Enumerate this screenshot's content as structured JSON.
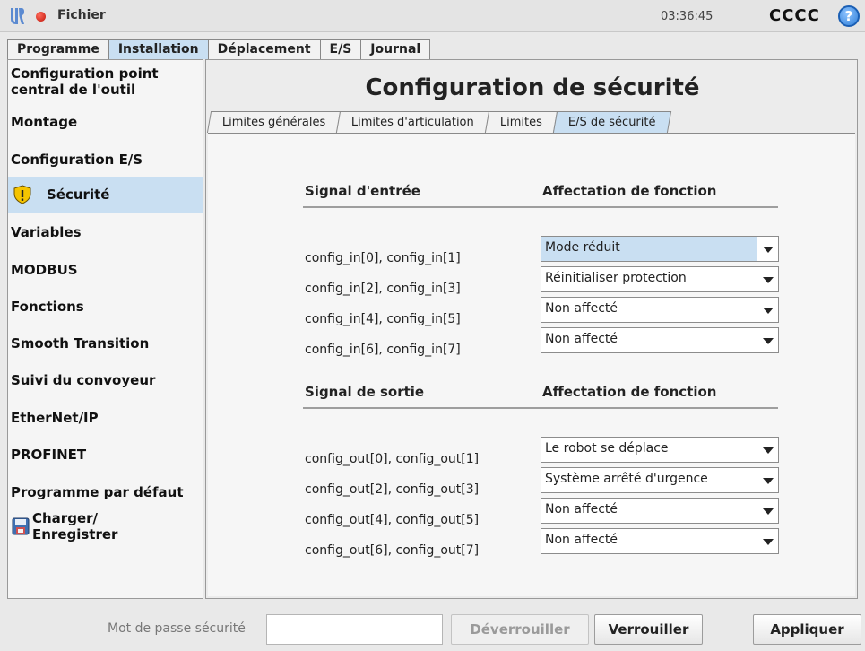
{
  "header": {
    "file_menu": "Fichier",
    "clock": "03:36:45",
    "robot_name": "CCCC",
    "help": "?"
  },
  "main_tabs": [
    "Programme",
    "Installation",
    "Déplacement",
    "E/S",
    "Journal"
  ],
  "sidebar": {
    "items": [
      "Configuration point\ncentral de l'outil",
      "Montage",
      "Configuration E/S",
      "Sécurité",
      "Variables",
      "MODBUS",
      "Fonctions",
      "Smooth Transition",
      "Suivi du convoyeur",
      "EtherNet/IP",
      "PROFINET",
      "Programme par défaut",
      "Charger/\nEnregistrer"
    ]
  },
  "page": {
    "title": "Configuration de sécurité",
    "sub_tabs": [
      "Limites générales",
      "Limites d'articulation",
      "Limites",
      "E/S de sécurité"
    ]
  },
  "inputs": {
    "signal_header": "Signal d'entrée",
    "function_header": "Affectation de fonction",
    "rows": [
      {
        "signal": "config_in[0], config_in[1]",
        "value": "Mode réduit"
      },
      {
        "signal": "config_in[2], config_in[3]",
        "value": "Réinitialiser protection"
      },
      {
        "signal": "config_in[4], config_in[5]",
        "value": "Non affecté"
      },
      {
        "signal": "config_in[6], config_in[7]",
        "value": "Non affecté"
      }
    ]
  },
  "outputs": {
    "signal_header": "Signal de sortie",
    "function_header": "Affectation de fonction",
    "rows": [
      {
        "signal": "config_out[0], config_out[1]",
        "value": "Le robot se déplace"
      },
      {
        "signal": "config_out[2], config_out[3]",
        "value": "Système arrêté d'urgence"
      },
      {
        "signal": "config_out[4], config_out[5]",
        "value": "Non affecté"
      },
      {
        "signal": "config_out[6], config_out[7]",
        "value": "Non affecté"
      }
    ]
  },
  "footer": {
    "password_label": "Mot de passe sécurité",
    "password_value": "",
    "unlock": "Déverrouiller",
    "lock": "Verrouiller",
    "apply": "Appliquer"
  },
  "colors": {
    "active_tab": "#c9dff2",
    "warning": "#f5c400",
    "help": "#2f7fd8"
  }
}
